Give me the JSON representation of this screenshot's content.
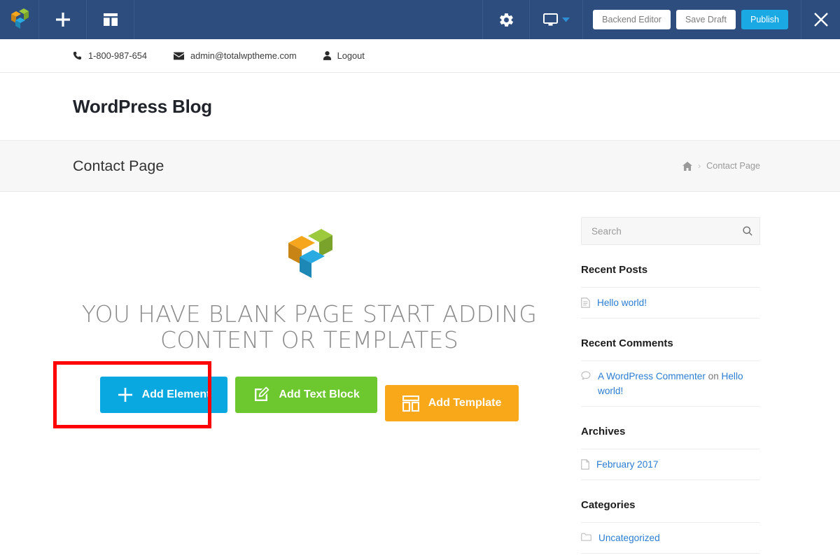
{
  "admin_bar": {
    "icons": {
      "logo": "wpbakery-logo-icon",
      "add": "plus-icon",
      "templates": "templates-grid-icon",
      "settings": "gear-icon",
      "responsive": "desktop-monitor-icon",
      "responsive_caret": "chevron-down-icon",
      "close": "close-icon"
    },
    "backend_editor_label": "Backend Editor",
    "save_draft_label": "Save Draft",
    "publish_label": "Publish",
    "accent_color": "#1ba9e4",
    "bar_color": "#2c4d7e"
  },
  "top_info": {
    "phone": "1-800-987-654",
    "email": "admin@totalwptheme.com",
    "logout": "Logout"
  },
  "site": {
    "title": "WordPress Blog"
  },
  "page_bar": {
    "title": "Contact Page",
    "breadcrumb_home_icon": "home-icon",
    "breadcrumb_separator": "›",
    "breadcrumb_current": "Contact Page"
  },
  "blank_page": {
    "heading": "You have blank page start adding content or templates",
    "logo_colors": {
      "orange_top": "#f5a61d",
      "orange_side": "#c88415",
      "green_top": "#9dc93c",
      "green_side": "#79a32b",
      "blue_top": "#29abe2",
      "blue_side": "#1d87b5"
    },
    "buttons": [
      {
        "label": "Add Element",
        "icon": "plus-icon",
        "color": "#0aa8e0"
      },
      {
        "label": "Add Text Block",
        "icon": "pencil-square-icon",
        "color": "#6dc72e"
      },
      {
        "label": "Add Template",
        "icon": "template-grid-icon",
        "color": "#f9a81a"
      }
    ],
    "highlight_color": "#ff0000",
    "highlighted_button": "Add Element"
  },
  "sidebar": {
    "search": {
      "placeholder": "Search",
      "submit_icon": "search-icon"
    },
    "widgets": [
      {
        "title": "Recent Posts",
        "items": [
          {
            "icon": "document-icon",
            "link": "Hello world!"
          }
        ]
      },
      {
        "title": "Recent Comments",
        "items": [
          {
            "icon": "comment-icon",
            "link": "A WordPress Commenter",
            "middle": " on ",
            "link2": "Hello world!"
          }
        ]
      },
      {
        "title": "Archives",
        "items": [
          {
            "icon": "page-icon",
            "link": "February 2017"
          }
        ]
      },
      {
        "title": "Categories",
        "items": [
          {
            "icon": "folder-icon",
            "link": "Uncategorized"
          }
        ]
      }
    ]
  }
}
